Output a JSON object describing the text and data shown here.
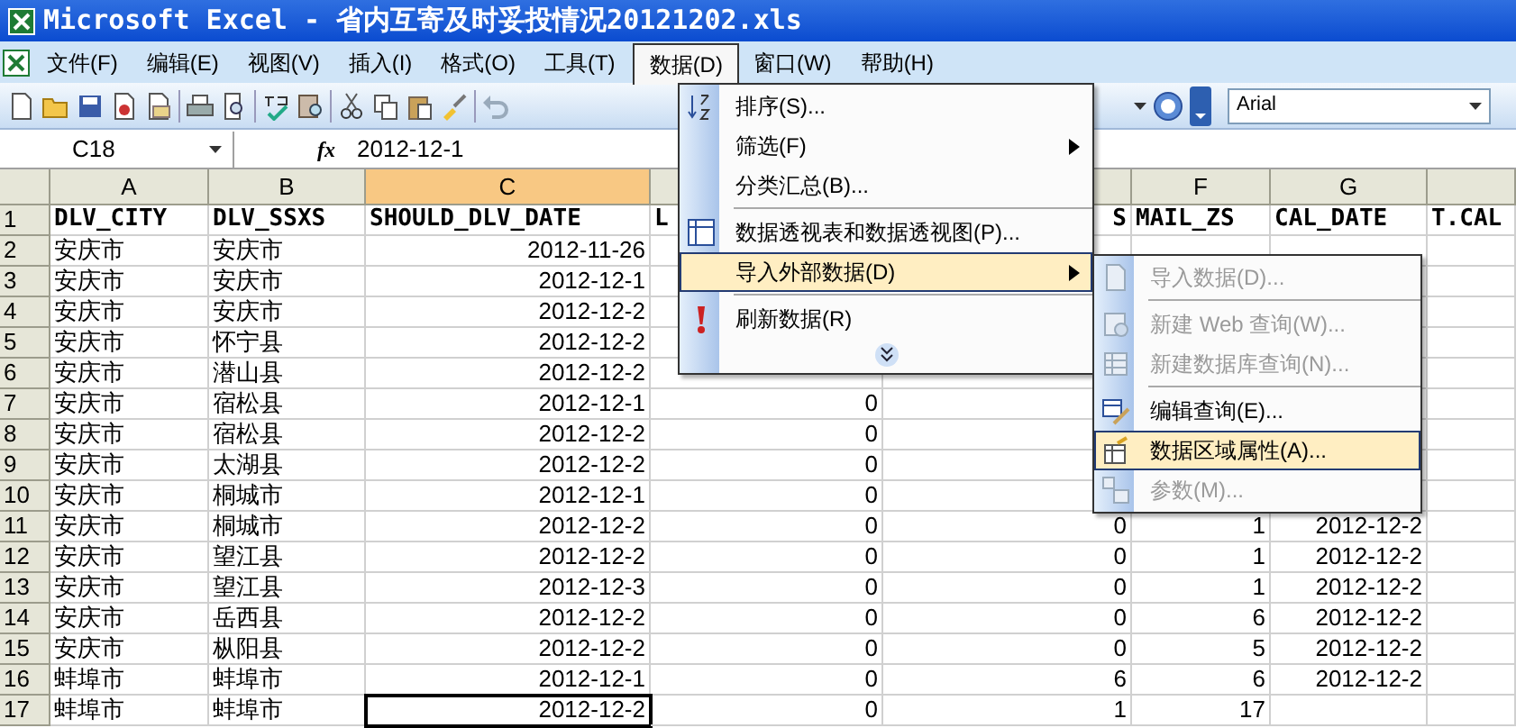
{
  "window": {
    "title": "Microsoft Excel - 省内互寄及时妥投情况20121202.xls"
  },
  "menu_bar": [
    {
      "label": "文件(F)",
      "selected": false
    },
    {
      "label": "编辑(E)",
      "selected": false
    },
    {
      "label": "视图(V)",
      "selected": false
    },
    {
      "label": "插入(I)",
      "selected": false
    },
    {
      "label": "格式(O)",
      "selected": false
    },
    {
      "label": "工具(T)",
      "selected": false
    },
    {
      "label": "数据(D)",
      "selected": true
    },
    {
      "label": "窗口(W)",
      "selected": false
    },
    {
      "label": "帮助(H)",
      "selected": false
    }
  ],
  "toolbar": {
    "font_name": "Arial"
  },
  "formula_bar": {
    "name_box": "C18",
    "fx": "fx",
    "formula": "2012-12-1"
  },
  "sheet": {
    "columns": [
      {
        "label": "A",
        "selected": false
      },
      {
        "label": "B",
        "selected": false
      },
      {
        "label": "C",
        "selected": true
      },
      {
        "selected": false
      },
      {
        "selected": false
      },
      {
        "label": "F",
        "selected": false
      },
      {
        "label": "G",
        "selected": false
      },
      {
        "selected": false
      }
    ],
    "rows": [
      {
        "number": "1",
        "kind": "header",
        "cells": [
          "DLV_CITY",
          "DLV_SSXS",
          "SHOULD_DLV_DATE",
          "L",
          {
            "text": "S",
            "clipped": true
          },
          "MAIL_ZS",
          "CAL_DATE",
          "T.CAL"
        ]
      },
      {
        "number": "2",
        "cells": [
          "安庆市",
          "安庆市",
          "2012-11-26",
          null,
          null,
          null,
          null,
          null
        ]
      },
      {
        "number": "3",
        "cells": [
          "安庆市",
          "安庆市",
          "2012-12-1",
          null,
          null,
          null,
          null,
          null
        ]
      },
      {
        "number": "4",
        "cells": [
          "安庆市",
          "安庆市",
          "2012-12-2",
          null,
          null,
          null,
          null,
          null
        ]
      },
      {
        "number": "5",
        "cells": [
          "安庆市",
          "怀宁县",
          "2012-12-2",
          null,
          null,
          null,
          null,
          null
        ]
      },
      {
        "number": "6",
        "cells": [
          "安庆市",
          "潜山县",
          "2012-12-2",
          null,
          null,
          null,
          null,
          null
        ]
      },
      {
        "number": "7",
        "cells": [
          "安庆市",
          "宿松县",
          "2012-12-1",
          "0",
          null,
          null,
          null,
          null
        ]
      },
      {
        "number": "8",
        "cells": [
          "安庆市",
          "宿松县",
          "2012-12-2",
          "0",
          null,
          null,
          null,
          null
        ]
      },
      {
        "number": "9",
        "cells": [
          "安庆市",
          "太湖县",
          "2012-12-2",
          "0",
          null,
          null,
          null,
          null
        ]
      },
      {
        "number": "10",
        "cells": [
          "安庆市",
          "桐城市",
          "2012-12-1",
          "0",
          null,
          null,
          null,
          null
        ]
      },
      {
        "number": "11",
        "cells": [
          "安庆市",
          "桐城市",
          "2012-12-2",
          "0",
          "0",
          "1",
          "2012-12-2",
          null
        ]
      },
      {
        "number": "12",
        "cells": [
          "安庆市",
          "望江县",
          "2012-12-2",
          "0",
          "0",
          "1",
          "2012-12-2",
          null
        ]
      },
      {
        "number": "13",
        "cells": [
          "安庆市",
          "望江县",
          "2012-12-3",
          "0",
          "0",
          "1",
          "2012-12-2",
          null
        ]
      },
      {
        "number": "14",
        "cells": [
          "安庆市",
          "岳西县",
          "2012-12-2",
          "0",
          "0",
          "6",
          "2012-12-2",
          null
        ]
      },
      {
        "number": "15",
        "cells": [
          "安庆市",
          "枞阳县",
          "2012-12-2",
          "0",
          "0",
          "5",
          "2012-12-2",
          null
        ]
      },
      {
        "number": "16",
        "cells": [
          "蚌埠市",
          "蚌埠市",
          "2012-12-1",
          "0",
          "6",
          "6",
          "2012-12-2",
          null
        ]
      },
      {
        "number": "17",
        "cells": [
          "蚌埠市",
          "蚌埠市",
          "2012-12-2",
          "0",
          "1",
          "17",
          null,
          null
        ]
      }
    ]
  },
  "data_menu": [
    {
      "kind": "item",
      "label": "排序(S)...",
      "submenu": false,
      "selected": false
    },
    {
      "kind": "item",
      "label": "筛选(F)",
      "submenu": true,
      "selected": false
    },
    {
      "kind": "item",
      "label": "分类汇总(B)...",
      "submenu": false,
      "selected": false
    },
    {
      "kind": "separator"
    },
    {
      "kind": "item",
      "label": "数据透视表和数据透视图(P)...",
      "submenu": false,
      "selected": false
    },
    {
      "kind": "item",
      "label": "导入外部数据(D)",
      "submenu": true,
      "selected": true
    },
    {
      "kind": "separator"
    },
    {
      "kind": "item",
      "label": "刷新数据(R)",
      "submenu": false,
      "selected": false
    },
    {
      "kind": "expand"
    }
  ],
  "external_data_menu": [
    {
      "label": "导入数据(D)...",
      "disabled": true,
      "selected": false
    },
    {
      "kind": "separator"
    },
    {
      "label": "新建 Web 查询(W)...",
      "disabled": true,
      "selected": false
    },
    {
      "label": "新建数据库查询(N)...",
      "disabled": true,
      "selected": false
    },
    {
      "kind": "separator"
    },
    {
      "label": "编辑查询(E)...",
      "disabled": false,
      "selected": false
    },
    {
      "label": "数据区域属性(A)...",
      "disabled": false,
      "selected": true
    },
    {
      "label": "参数(M)...",
      "disabled": true,
      "selected": false
    }
  ]
}
